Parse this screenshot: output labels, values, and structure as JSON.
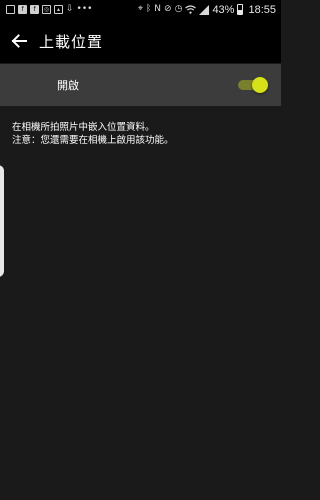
{
  "status_bar": {
    "battery_percent": "43%",
    "battery_level": 0.43,
    "time": "18:55",
    "left_icons": [
      "notification-box-icon",
      "facebook-icon",
      "facebook-icon",
      "camera-box-icon",
      "image-icon",
      "download-icon",
      "more-dots-icon"
    ],
    "right_icons": [
      "location-icon",
      "bluetooth-icon",
      "nfc-icon",
      "mute-icon",
      "alarm-icon",
      "wifi-icon",
      "signal-icon",
      "battery-icon"
    ]
  },
  "app_bar": {
    "title": "上載位置",
    "back_icon": "arrow-left-icon"
  },
  "setting": {
    "toggle_label": "開啟",
    "toggle_on": true,
    "accent_color": "#d7e11a"
  },
  "description": {
    "line1": "在相機所拍照片中嵌入位置資料。",
    "line2": "注意：您還需要在相機上啟用該功能。"
  }
}
